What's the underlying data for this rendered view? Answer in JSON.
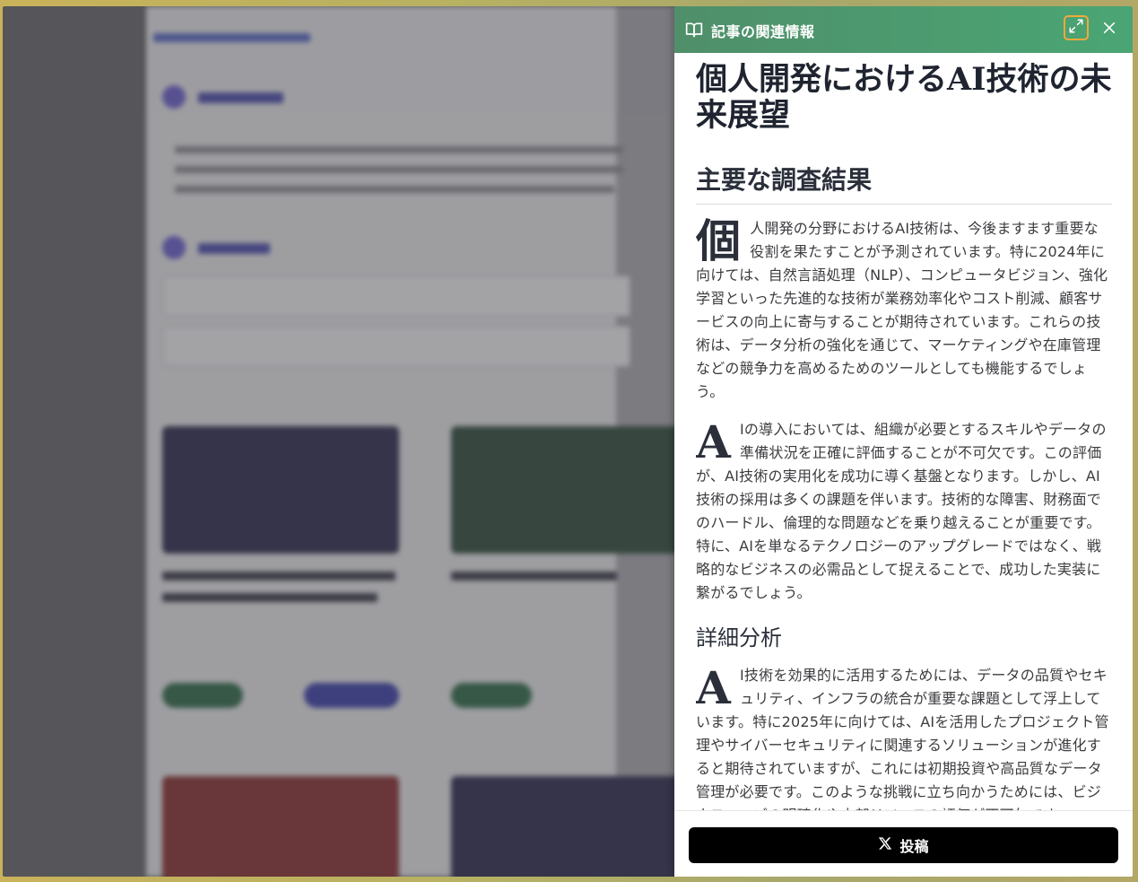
{
  "drawer": {
    "header_title": "記事の関連情報",
    "header_icon": "book-open-icon",
    "expand_icon": "expand-icon",
    "close_icon": "close-icon",
    "accent_color": "#4aa574",
    "focus_ring_color": "#f2a93b"
  },
  "article": {
    "title": "個人開発におけるAI技術の未来展望",
    "sections": [
      {
        "heading": "主要な調査結果",
        "paragraphs": [
          {
            "dropcap": "個",
            "text": "人開発の分野におけるAI技術は、今後ますます重要な役割を果たすことが予測されています。特に2024年に向けては、自然言語処理（NLP）、コンピュータビジョン、強化学習といった先進的な技術が業務効率化やコスト削減、顧客サービスの向上に寄与することが期待されています。これらの技術は、データ分析の強化を通じて、マーケティングや在庫管理などの競争力を高めるためのツールとしても機能するでしょう。"
          },
          {
            "dropcap": "A",
            "text": "Iの導入においては、組織が必要とするスキルやデータの準備状況を正確に評価することが不可欠です。この評価が、AI技術の実用化を成功に導く基盤となります。しかし、AI技術の採用は多くの課題を伴います。技術的な障害、財務面でのハードル、倫理的な問題などを乗り越えることが重要です。特に、AIを単なるテクノロジーのアップグレードではなく、戦略的なビジネスの必需品として捉えることで、成功した実装に繋がるでしょう。"
          }
        ]
      },
      {
        "heading": "詳細分析",
        "paragraphs": [
          {
            "dropcap": "A",
            "text": "I技術を効果的に活用するためには、データの品質やセキュリティ、インフラの統合が重要な課題として浮上しています。特に2025年に向けては、AIを活用したプロジェクト管理やサイバーセキュリティに関連するソリューションが進化すると期待されていますが、これには初期投資や高品質なデータ管理が必要です。このような挑戦に立ち向かうためには、ビジネスニーズの明確化や内部リソースの評価が不可欠です。"
          }
        ]
      }
    ]
  },
  "footer": {
    "post_label": "投稿",
    "post_icon": "x-logo-icon"
  }
}
